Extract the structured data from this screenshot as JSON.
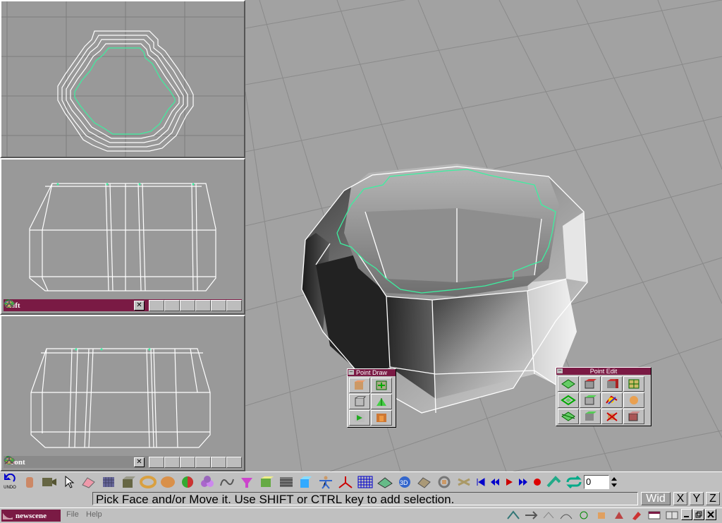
{
  "viewports": {
    "top": {
      "label": ""
    },
    "left": {
      "label": "Left"
    },
    "front": {
      "label": "Front"
    }
  },
  "palettes": {
    "point_draw": {
      "title": "Point Draw",
      "minimize": "–"
    },
    "point_edit": {
      "title": "Point Edit",
      "minimize": "–"
    }
  },
  "toolbar": {
    "undo_label": "UNDO",
    "frame_value": "0"
  },
  "status": {
    "message": "Pick Face and/or Move it. Use SHIFT or CTRL key to add selection.",
    "wid_label": "Wid",
    "axes": [
      "X",
      "Y",
      "Z"
    ]
  },
  "taskbar": {
    "scene_name": "newscene",
    "menu": [
      "File",
      "Help"
    ]
  },
  "colors": {
    "title_bar": "#7a1a44",
    "viewport_bg": "#999999",
    "wire": "#ffffff",
    "selection": "#3cf0a0"
  }
}
